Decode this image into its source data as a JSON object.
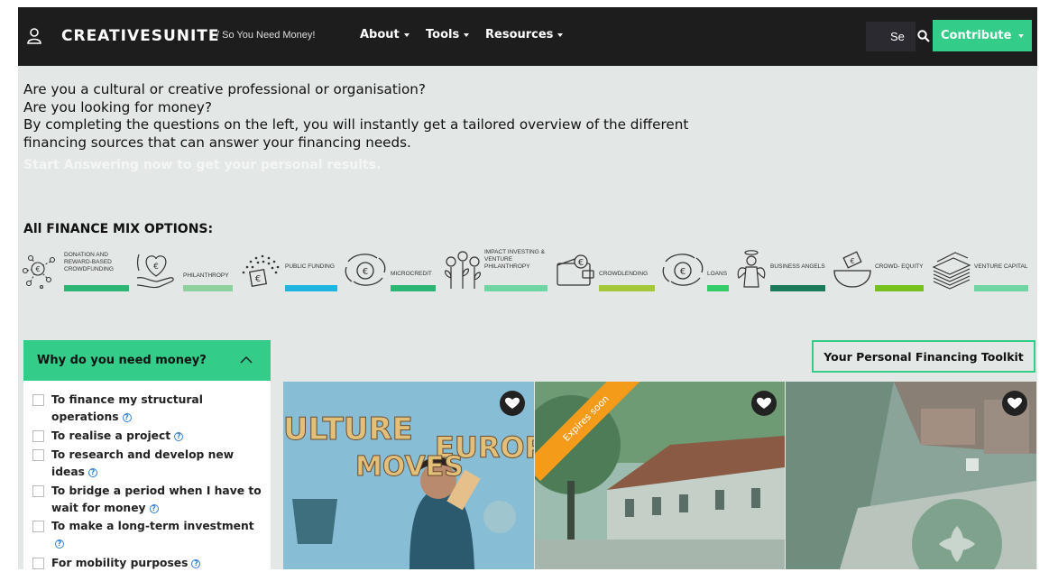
{
  "navbar": {
    "logo": "CREATIVESUNITE",
    "breadcrumb": "/ So You Need Money!",
    "menu": [
      {
        "label": "About"
      },
      {
        "label": "Tools"
      },
      {
        "label": "Resources"
      }
    ],
    "search_value": "Se",
    "contribute_label": "Contribute",
    "user_icon": "user-icon",
    "search_icon": "search-icon"
  },
  "intro": {
    "lines": [
      "Are you a cultural or creative professional or organisation?",
      "Are you looking for money?",
      "By completing the questions on the left, you will instantly get a tailored overview of the different",
      "financing sources that can answer your financing needs."
    ],
    "cta": "Start Answering now to get your personal results."
  },
  "finance_mix": {
    "title": "All FINANCE MIX OPTIONS:",
    "options": [
      {
        "label": "DONATION AND REWARD-BASED CROWDFUNDING",
        "color": "#2bb673",
        "icon": "network-icon"
      },
      {
        "label": "PHILANTHROPY",
        "color": "#8fd19e",
        "icon": "heart-hand-icon"
      },
      {
        "label": "PUBLIC FUNDING",
        "color": "#1fb5e0",
        "icon": "euro-dots-icon"
      },
      {
        "label": "MICROCREDIT",
        "color": "#2bb673",
        "icon": "hand-coin-icon"
      },
      {
        "label": "IMPACT INVESTING & VENTURE PHILANTHROPY",
        "color": "#6fd6a3",
        "icon": "plants-icon"
      },
      {
        "label": "CROWDLENDING",
        "color": "#a5c83a",
        "icon": "wallet-icon"
      },
      {
        "label": "LOANS",
        "color": "#33cc66",
        "icon": "coin-hands-icon"
      },
      {
        "label": "BUSINESS ANGELS",
        "color": "#1b7a5a",
        "icon": "angel-icon"
      },
      {
        "label": "CROWD- EQUITY",
        "color": "#77c11c",
        "icon": "bowl-icon"
      },
      {
        "label": "VENTURE CAPITAL",
        "color": "#6fd6a3",
        "icon": "cash-stack-icon"
      }
    ]
  },
  "sidebar": {
    "title": "Why do you need money?",
    "options": [
      {
        "label": "To finance my structural operations"
      },
      {
        "label": "To realise a project"
      },
      {
        "label": "To research and develop new ideas"
      },
      {
        "label": "To bridge a period when I have to wait for money"
      },
      {
        "label": "To make a long-term investment"
      },
      {
        "label": "For mobility purposes"
      }
    ]
  },
  "toolkit": {
    "label": "Your Personal Financing Toolkit"
  },
  "cards": [
    {
      "image_text": "CULTURE MOVES EUROPE",
      "ribbon": ""
    },
    {
      "image_text": "",
      "ribbon": "Expires soon"
    },
    {
      "image_text": "",
      "ribbon": ""
    }
  ],
  "colors": {
    "accent": "#33cc88",
    "navbar": "#1d1d1d",
    "background": "#e3e8e6",
    "ribbon": "#f49b1a"
  }
}
